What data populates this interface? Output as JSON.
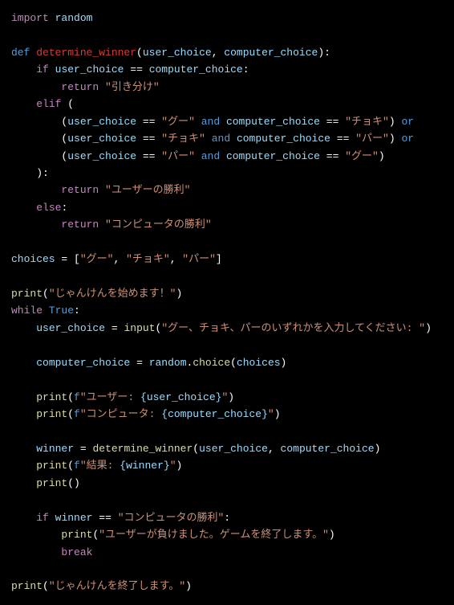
{
  "code": {
    "l1_import": "import",
    "l1_mod": "random",
    "l3_def": "def",
    "l3_fn": "determine_winner",
    "l3_p1": "user_choice",
    "l3_p2": "computer_choice",
    "l4_if": "if",
    "l4_v1": "user_choice",
    "l4_v2": "computer_choice",
    "l5_ret": "return",
    "l5_s": "\"引き分け\"",
    "l6_elif": "elif",
    "l7_v1": "user_choice",
    "l7_s1": "\"グー\"",
    "l7_and": "and",
    "l7_v2": "computer_choice",
    "l7_s2": "\"チョキ\"",
    "l7_or": "or",
    "l8_v1": "user_choice",
    "l8_s1": "\"チョキ\"",
    "l8_and": "and",
    "l8_v2": "computer_choice",
    "l8_s2": "\"パー\"",
    "l8_or": "or",
    "l9_v1": "user_choice",
    "l9_s1": "\"パー\"",
    "l9_and": "and",
    "l9_v2": "computer_choice",
    "l9_s2": "\"グー\"",
    "l11_ret": "return",
    "l11_s": "\"ユーザーの勝利\"",
    "l12_else": "else",
    "l13_ret": "return",
    "l13_s": "\"コンピュータの勝利\"",
    "l15_v": "choices",
    "l15_s1": "\"グー\"",
    "l15_s2": "\"チョキ\"",
    "l15_s3": "\"パー\"",
    "l17_print": "print",
    "l17_s": "\"じゃんけんを始めます！\"",
    "l18_while": "while",
    "l18_true": "True",
    "l19_v": "user_choice",
    "l19_input": "input",
    "l19_s": "\"グー、チョキ、パーのいずれかを入力してください: \"",
    "l21_v": "computer_choice",
    "l21_mod": "random",
    "l21_fn": "choice",
    "l21_arg": "choices",
    "l23_print": "print",
    "l23_f": "f",
    "l23_s1": "\"ユーザー: ",
    "l23_v": "{user_choice}",
    "l23_s2": "\"",
    "l24_print": "print",
    "l24_f": "f",
    "l24_s1": "\"コンピュータ: ",
    "l24_v": "{computer_choice}",
    "l24_s2": "\"",
    "l26_v": "winner",
    "l26_fn": "determine_winner",
    "l26_a1": "user_choice",
    "l26_a2": "computer_choice",
    "l27_print": "print",
    "l27_f": "f",
    "l27_s1": "\"結果: ",
    "l27_v": "{winner}",
    "l27_s2": "\"",
    "l28_print": "print",
    "l30_if": "if",
    "l30_v": "winner",
    "l30_s": "\"コンピュータの勝利\"",
    "l31_print": "print",
    "l31_s": "\"ユーザーが負けました。ゲームを終了します。\"",
    "l32_break": "break",
    "l34_print": "print",
    "l34_s": "\"じゃんけんを終了します。\""
  }
}
